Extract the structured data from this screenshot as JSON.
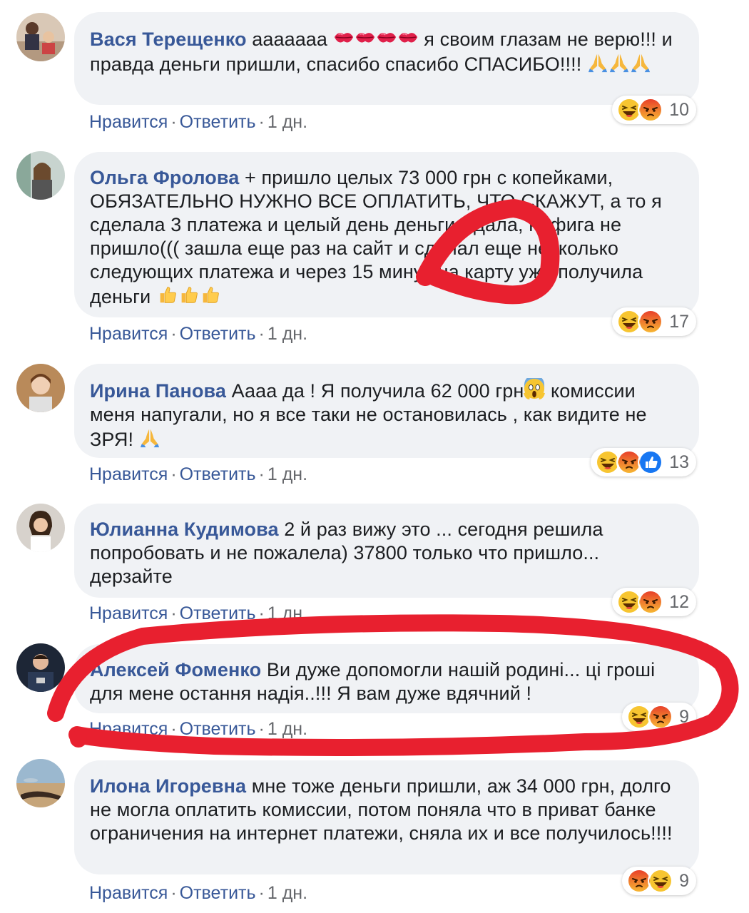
{
  "comments": [
    {
      "author": "Вася Терещенко",
      "text_a": " аааааaa ",
      "text_b": " я своим глазам не верю!!! и правда деньги пришли, спасибо спасибо СПАСИБО!!!! ",
      "reaction_count": "10",
      "like": "Нравится",
      "reply": "Ответить",
      "time": "1 дн."
    },
    {
      "author": "Ольга Фролова",
      "text_a": " + пришло целых 73 000 грн с копейками, ОБЯЗАТЕЛЬНО НУЖНО ВСЕ ОПЛАТИТЬ, ЧТО СКАЖУТ, а то я сделала 3 платежа и целый день деньги ждала, нифига не пришло((( зашла еще раз на сайт и сделал еще несколько следующих платежа и через 15 минут на карту уже получила деньги ",
      "reaction_count": "17",
      "like": "Нравится",
      "reply": "Ответить",
      "time": "1 дн."
    },
    {
      "author": "Ирина Панова",
      "text_a": " Аааа да ! Я получила 62 000 грн",
      "text_b": " комиссии меня напугали, но я все таки не остановилась , как видите не ЗРЯ! ",
      "reaction_count": "13",
      "like": "Нравится",
      "reply": "Ответить",
      "time": "1 дн."
    },
    {
      "author": "Юлианна Кудимова",
      "text_a": " 2 й раз вижу это ... сегодня решила попробовать и не пожалела) 37800 только что пришло... дерзайте",
      "reaction_count": "12",
      "like": "Нравится",
      "reply": "Ответить",
      "time": "1 дн."
    },
    {
      "author": "Алексей Фоменко",
      "text_a": " Ви дуже допомогли нашій родині... ці гроші для мене остання надія..!!! Я вам дуже вдячний !",
      "reaction_count": "9",
      "like": "Нравится",
      "reply": "Ответить",
      "time": "1 дн."
    },
    {
      "author": "Илона Игоревна",
      "text_a": " мне тоже деньги пришли, аж 34 000 грн, долго не могла оплатить комиссии, потом поняла что в приват банке ограничения на интернет платежи, сняла их и все получилось!!!!",
      "reaction_count": "9",
      "like": "Нравится",
      "reply": "Ответить",
      "time": "1 дн."
    }
  ],
  "separator": "·",
  "colors": {
    "author": "#385898",
    "bubble": "#f0f2f5",
    "meta": "#65676b",
    "annotation": "#e8202f"
  }
}
